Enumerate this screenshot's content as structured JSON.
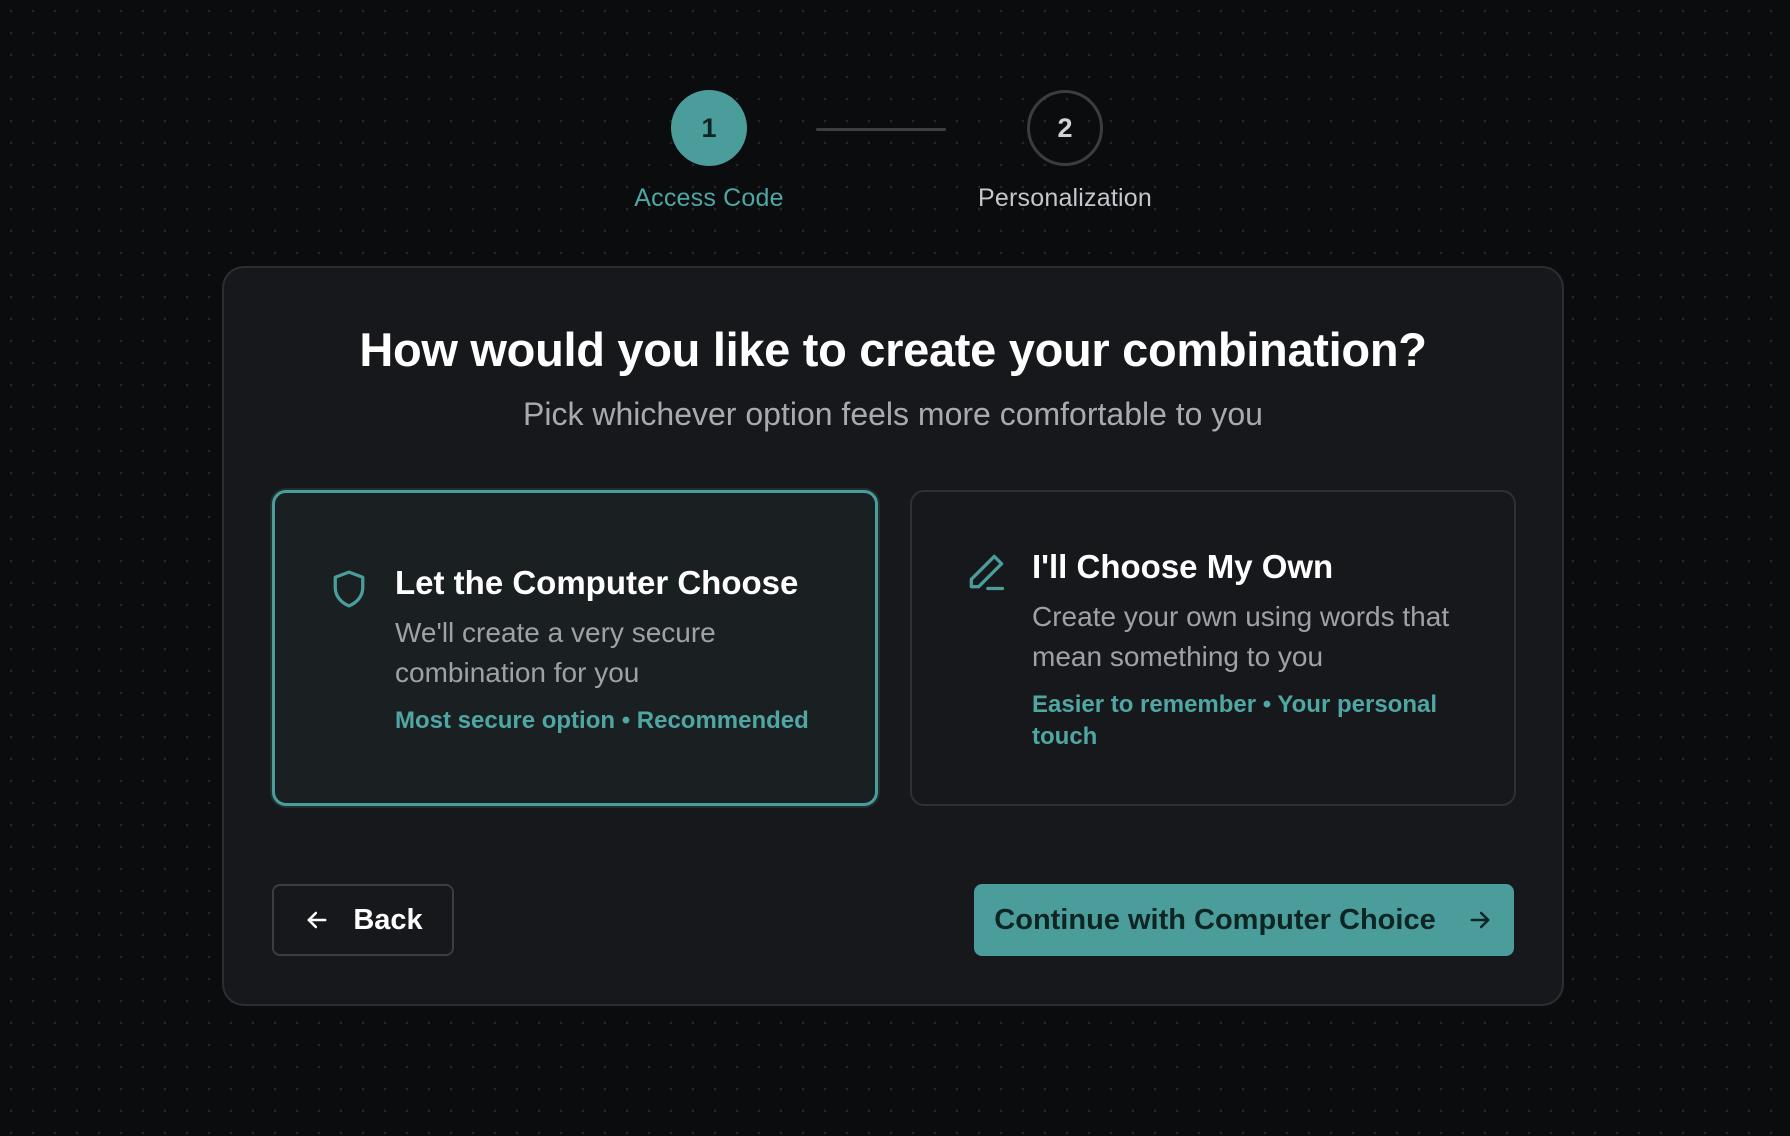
{
  "stepper": {
    "steps": [
      {
        "number": "1",
        "label": "Access Code",
        "state": "active"
      },
      {
        "number": "2",
        "label": "Personalization",
        "state": "upcoming"
      }
    ]
  },
  "card": {
    "title": "How would you like to create your combination?",
    "subtitle": "Pick whichever option feels more comfortable to you",
    "options": [
      {
        "icon": "shield-icon",
        "title": "Let the Computer Choose",
        "description": "We'll create a very secure combination for you",
        "tags": "Most secure option • Recommended",
        "selected": true
      },
      {
        "icon": "pencil-icon",
        "title": "I'll Choose My Own",
        "description": "Create your own using words that mean something to you",
        "tags": "Easier to remember • Your personal touch",
        "selected": false
      }
    ]
  },
  "actions": {
    "back_label": "Back",
    "continue_label": "Continue with Computer Choice"
  },
  "colors": {
    "accent": "#4a9d9b",
    "background": "#0b0c0e",
    "card": "#17181b"
  }
}
